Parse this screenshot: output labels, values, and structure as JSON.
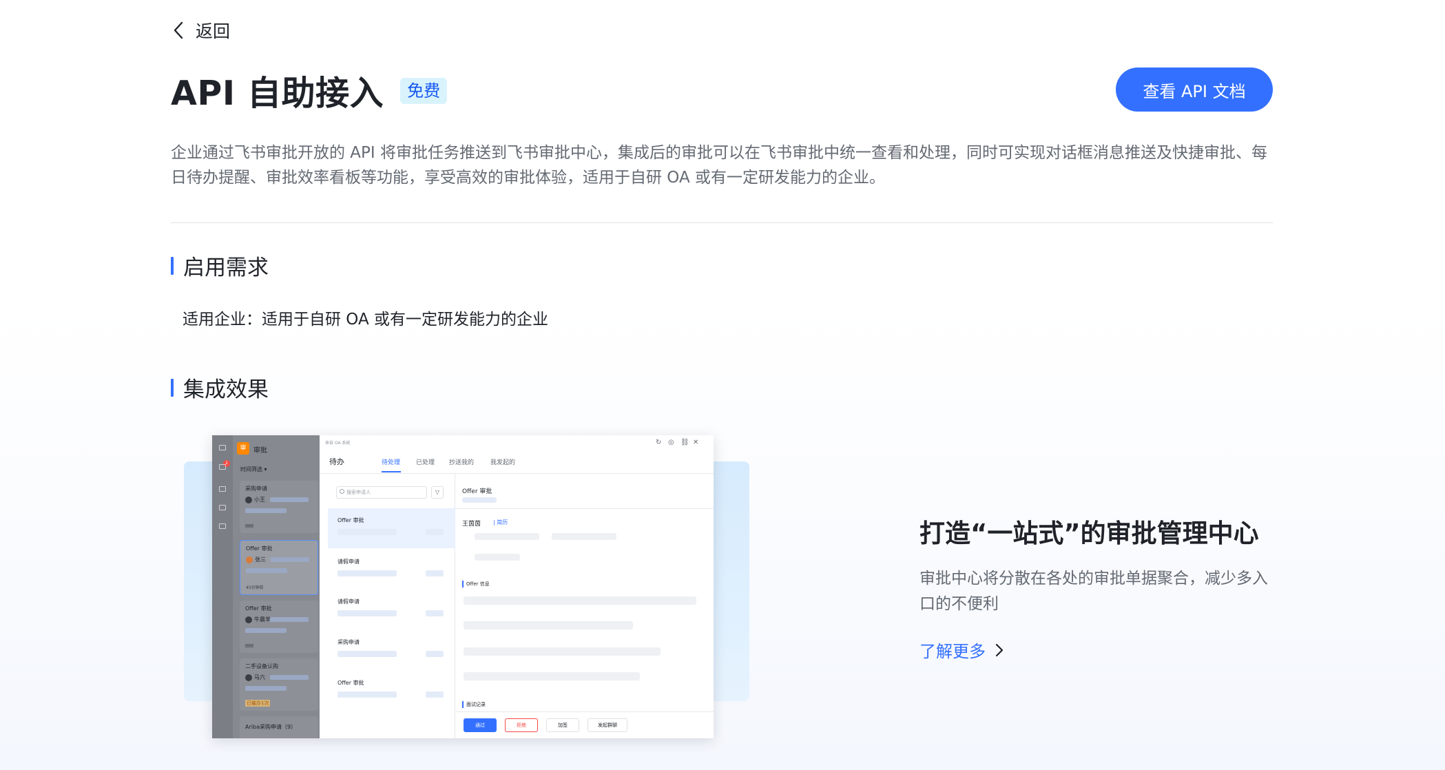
{
  "nav": {
    "back_label": "返回"
  },
  "header": {
    "title": "API 自助接入",
    "badge": "免费",
    "doc_button": "查看 API 文档",
    "description": "企业通过飞书审批开放的 API 将审批任务推送到飞书审批中心，集成后的审批可以在飞书审批中统一查看和处理，同时可实现对话框消息推送及快捷审批、每日待办提醒、审批效率看板等功能，享受高效的审批体验，适用于自研 OA 或有一定研发能力的企业。"
  },
  "requirements": {
    "title": "启用需求",
    "text": "适用企业：适用于自研 OA 或有一定研发能力的企业"
  },
  "effect": {
    "title": "集成效果",
    "feature_title": "打造“一站式”的审批管理中心",
    "feature_desc": "审批中心将分散在各处的审批单据聚合，减少多入口的不便利",
    "learn_more": "了解更多"
  },
  "mock": {
    "app_logo": "审",
    "app_title": "审批",
    "rail_badge": "1",
    "time_filter": "时间筛选 ▾",
    "cards": [
      {
        "title": "采购申请",
        "user": "小王",
        "footer": "刚刚"
      },
      {
        "title": "Offer 审批",
        "user": "张三",
        "footer": "45分钟前"
      },
      {
        "title": "Offer 审批",
        "user": "牛晨羊",
        "footer": "刚刚"
      },
      {
        "title": "二手设备认购",
        "user": "马六",
        "footer": "已催办1次"
      },
      {
        "title": "Ariba采购申请（9）",
        "user": "",
        "footer": ""
      }
    ],
    "source": "来自 OA 系统",
    "todo": "待办",
    "tabs": [
      "待处理",
      "已处理",
      "抄送我的",
      "我发起的"
    ],
    "toolbar_icons": [
      "↻",
      "◎",
      "⛓",
      "✕"
    ],
    "search_placeholder": "搜索申请人",
    "filter_icon": "▽",
    "list_items": [
      "Offer 审批",
      "请假申请",
      "请假申请",
      "采购申请",
      "Offer 审批"
    ],
    "detail_title": "Offer 审批",
    "applicant": "王茵茵",
    "resume_link": "| 简历",
    "offer_info": "Offer 信息",
    "interview_record": "面试记录",
    "buttons": [
      "通过",
      "拒绝",
      "加签",
      "发起群聊"
    ]
  }
}
